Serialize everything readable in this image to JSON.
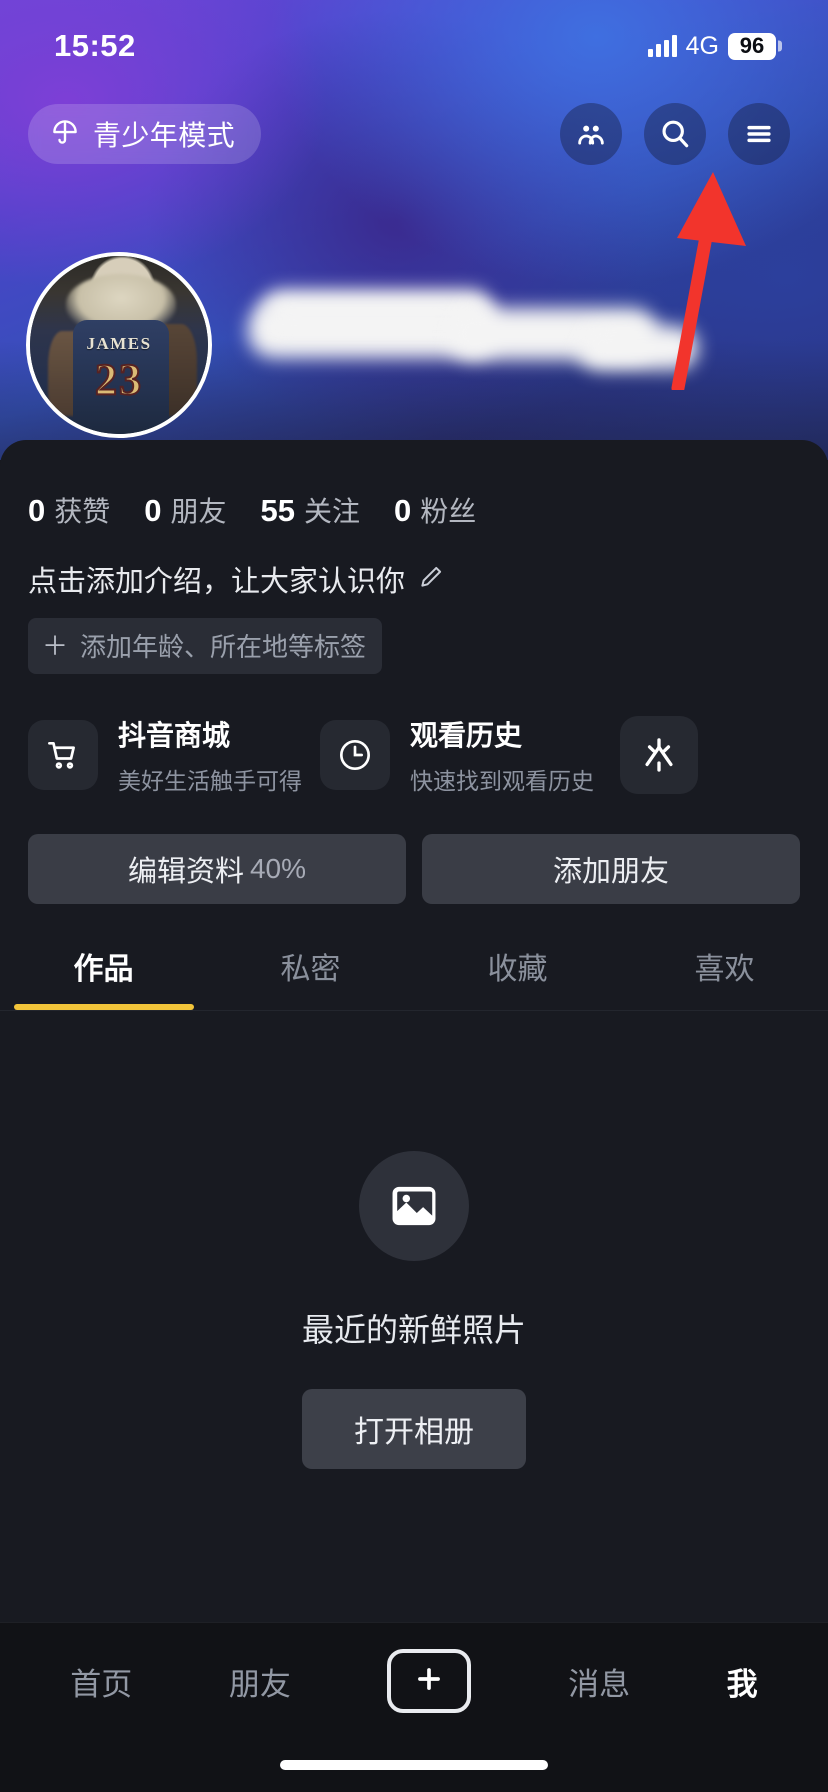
{
  "status_bar": {
    "time": "15:52",
    "network": "4G",
    "battery": "96",
    "signal_icon": "signal-bars-icon",
    "battery_icon": "battery-icon"
  },
  "header": {
    "teen_mode": {
      "label": "青少年模式",
      "icon": "umbrella-icon"
    },
    "actions": [
      {
        "name": "friends-icon",
        "label": "朋友"
      },
      {
        "name": "search-icon",
        "label": "搜索"
      },
      {
        "name": "menu-icon",
        "label": "菜单"
      }
    ]
  },
  "annotation": {
    "arrow_color": "#f2342c",
    "points_to": "menu-icon"
  },
  "profile": {
    "avatar": {
      "name_text": "JAMES",
      "number_text": "23",
      "alt": "LeBron James jersey avatar"
    },
    "nickname_redacted": true,
    "stats": [
      {
        "num": "0",
        "label": "获赞"
      },
      {
        "num": "0",
        "label": "朋友"
      },
      {
        "num": "55",
        "label": "关注"
      },
      {
        "num": "0",
        "label": "粉丝"
      }
    ],
    "bio_placeholder": "点击添加介绍，让大家认识你",
    "bio_edit_icon": "pencil-icon",
    "tag_chip": {
      "plus": "＋",
      "label": "添加年龄、所在地等标签"
    }
  },
  "shortcuts": [
    {
      "icon": "shopping-cart-icon",
      "title": "抖音商城",
      "subtitle": "美好生活触手可得"
    },
    {
      "icon": "clock-icon",
      "title": "观看历史",
      "subtitle": "快速找到观看历史"
    },
    {
      "icon": "douyin-spark-icon",
      "title": "",
      "subtitle": ""
    }
  ],
  "actions": {
    "edit_profile_label": "编辑资料",
    "edit_profile_percent": "40%",
    "add_friend_label": "添加朋友"
  },
  "tabs": [
    {
      "label": "作品",
      "active": true
    },
    {
      "label": "私密",
      "active": false
    },
    {
      "label": "收藏",
      "active": false
    },
    {
      "label": "喜欢",
      "active": false
    }
  ],
  "tab_accent_color": "#f2c43a",
  "empty_state": {
    "icon": "image-placeholder-icon",
    "title": "最近的新鲜照片",
    "button_label": "打开相册"
  },
  "bottom_nav": [
    {
      "label": "首页",
      "active": false
    },
    {
      "label": "朋友",
      "active": false
    },
    {
      "label": "",
      "active": false,
      "icon": "plus-icon"
    },
    {
      "label": "消息",
      "active": false
    },
    {
      "label": "我",
      "active": true
    }
  ]
}
